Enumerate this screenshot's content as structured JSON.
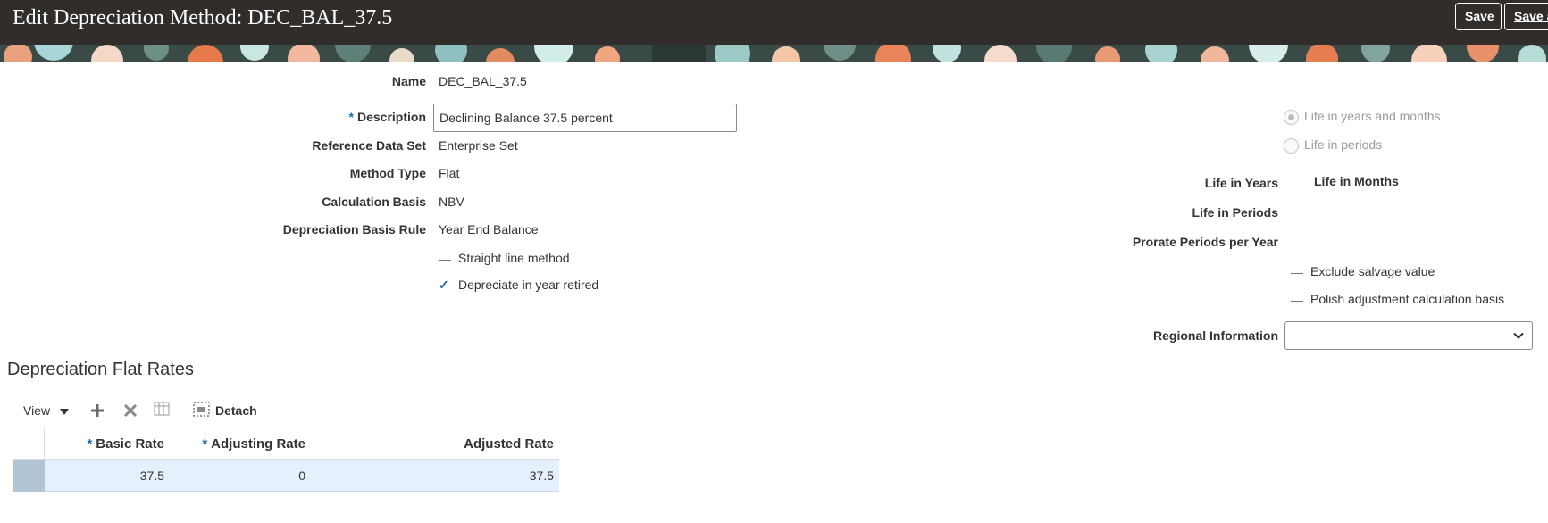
{
  "header": {
    "title": "Edit Depreciation Method: DEC_BAL_37.5",
    "save_label": "Save",
    "save_and_close_label": "Save and Close"
  },
  "form": {
    "name_label": "Name",
    "name_value": "DEC_BAL_37.5",
    "description_required": "*",
    "description_label": "Description",
    "description_value": "Declining Balance 37.5 percent",
    "reference_data_set_label": "Reference Data Set",
    "reference_data_set_value": "Enterprise Set",
    "method_type_label": "Method Type",
    "method_type_value": "Flat",
    "calculation_basis_label": "Calculation Basis",
    "calculation_basis_value": "NBV",
    "depreciation_basis_rule_label": "Depreciation Basis Rule",
    "depreciation_basis_rule_value": "Year End Balance",
    "straight_line_label": "Straight line method",
    "straight_line_checked": false,
    "depreciate_in_year_retired_label": "Depreciate in year retired",
    "depreciate_in_year_retired_checked": true,
    "check_mark": "✓"
  },
  "life": {
    "radio_years_months_label": "Life in years and months",
    "radio_years_months_selected": true,
    "radio_periods_label": "Life in periods",
    "radio_periods_selected": false,
    "life_in_years_label": "Life in Years",
    "life_in_months_label": "Life in Months",
    "life_in_periods_label": "Life in Periods",
    "prorate_periods_label": "Prorate Periods per Year",
    "exclude_salvage_label": "Exclude salvage value",
    "exclude_salvage_checked": false,
    "polish_adjustment_label": "Polish adjustment calculation basis",
    "polish_adjustment_checked": false,
    "regional_info_label": "Regional Information",
    "regional_info_value": ""
  },
  "rates": {
    "section_title": "Depreciation Flat Rates",
    "toolbar": {
      "view_label": "View",
      "detach_label": "Detach"
    },
    "columns": {
      "required_mark": "*",
      "basic_rate": "Basic Rate",
      "adjusting_rate": "Adjusting Rate",
      "adjusted_rate": "Adjusted Rate"
    },
    "rows": [
      {
        "basic_rate": "37.5",
        "adjusting_rate": "0",
        "adjusted_rate": "37.5"
      }
    ]
  },
  "colors": {
    "header_bg": "#312d2a",
    "required_accent": "#1c6aa8",
    "selected_row": "#e4f0fb"
  }
}
